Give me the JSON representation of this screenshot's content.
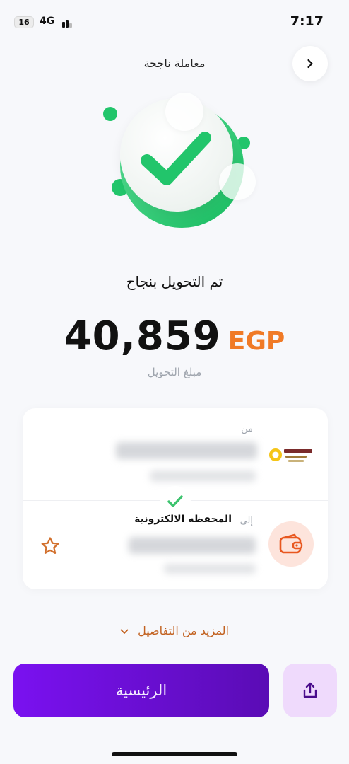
{
  "status_bar": {
    "battery": "16",
    "network": "4G",
    "time": "7:17"
  },
  "header": {
    "title": "معاملة ناجحة",
    "back_icon": "chevron-right-icon"
  },
  "result": {
    "message": "تم التحويل بنجاح",
    "amount": "40,859",
    "currency": "EGP",
    "amount_label": "مبلغ التحويل"
  },
  "transfer": {
    "from_label": "من",
    "bank_logo": "banque-misr-logo",
    "to_label": "إلى",
    "to_name": "المحفظه الالكترونية",
    "wallet_icon": "wallet-icon",
    "favorite_icon": "star-icon"
  },
  "more_details": "المزيد من التفاصيل",
  "actions": {
    "home_label": "الرئيسية",
    "share_icon": "share-icon"
  },
  "colors": {
    "accent_orange": "#f07a26",
    "success_green": "#22c56b",
    "primary_purple": "#6a0fd4",
    "share_bg": "#efdafc"
  }
}
